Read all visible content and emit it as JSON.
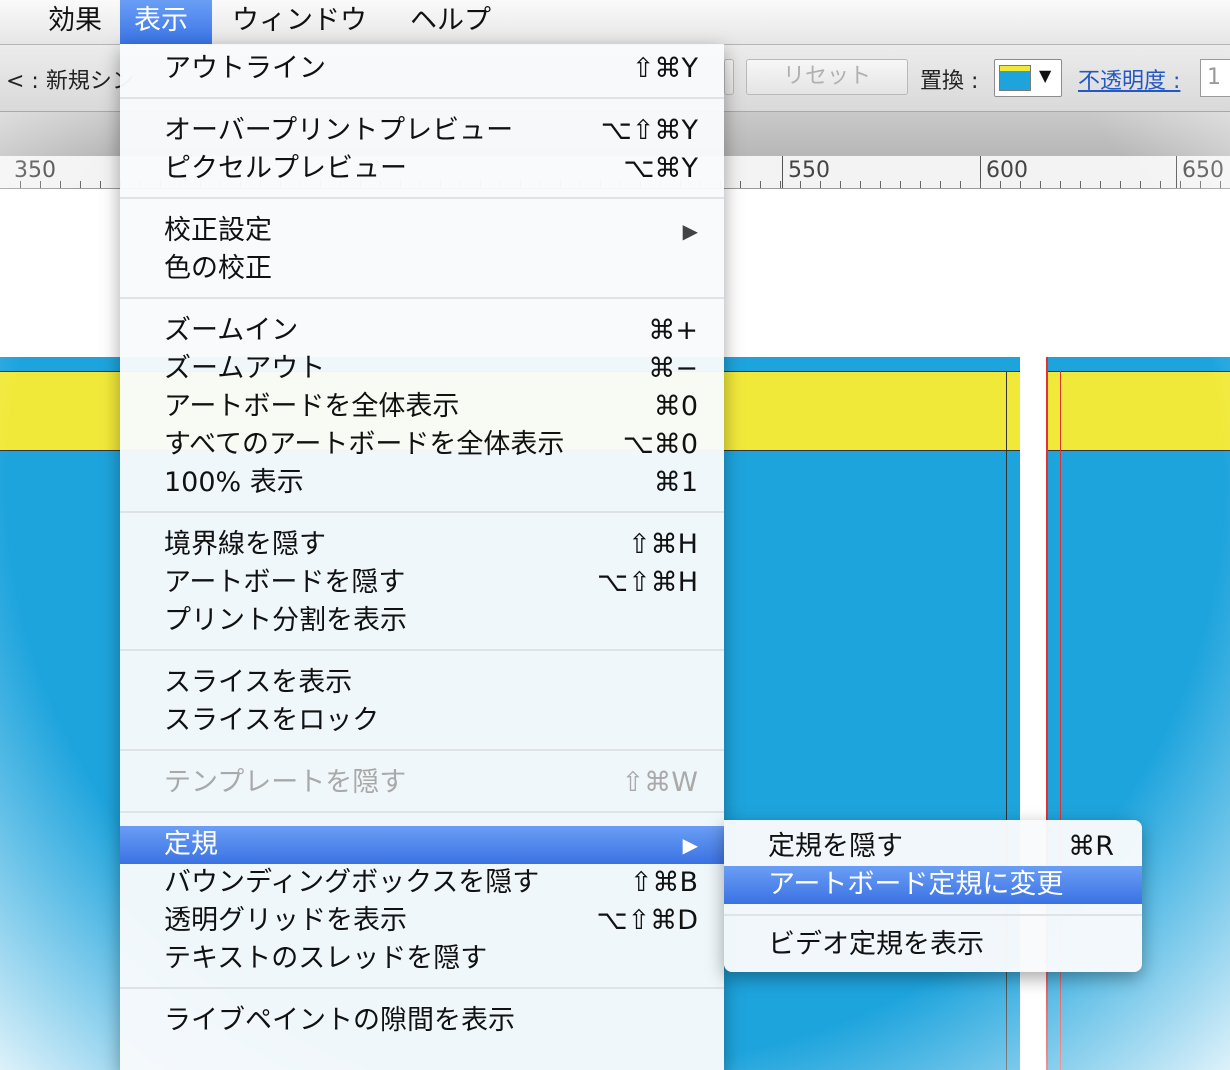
{
  "menubar": {
    "items": [
      {
        "label": "効果",
        "active": false
      },
      {
        "label": "表示",
        "active": true
      },
      {
        "label": "ウィンドウ",
        "active": false
      },
      {
        "label": "ヘルプ",
        "active": false
      }
    ]
  },
  "controlbar": {
    "new_symbol_partial": "< : 新規シン",
    "reset_label": "リセット",
    "replace_label": "置換 :",
    "opacity_label": "不透明度 :",
    "opacity_value": "1"
  },
  "ruler": {
    "labels": [
      "350",
      "550",
      "600",
      "650"
    ]
  },
  "view_menu": {
    "groups": [
      [
        {
          "label": "アウトライン",
          "shortcut": "⇧⌘Y"
        }
      ],
      [
        {
          "label": "オーバープリントプレビュー",
          "shortcut": "⌥⇧⌘Y"
        },
        {
          "label": "ピクセルプレビュー",
          "shortcut": "⌥⌘Y"
        }
      ],
      [
        {
          "label": "校正設定",
          "submenu": true
        },
        {
          "label": "色の校正"
        }
      ],
      [
        {
          "label": "ズームイン",
          "shortcut": "⌘+"
        },
        {
          "label": "ズームアウト",
          "shortcut": "⌘−"
        },
        {
          "label": "アートボードを全体表示",
          "shortcut": "⌘0"
        },
        {
          "label": "すべてのアートボードを全体表示",
          "shortcut": "⌥⌘0"
        },
        {
          "label": "100% 表示",
          "shortcut": "⌘1"
        }
      ],
      [
        {
          "label": "境界線を隠す",
          "shortcut": "⇧⌘H"
        },
        {
          "label": "アートボードを隠す",
          "shortcut": "⌥⇧⌘H"
        },
        {
          "label": "プリント分割を表示"
        }
      ],
      [
        {
          "label": "スライスを表示"
        },
        {
          "label": "スライスをロック"
        }
      ],
      [
        {
          "label": "テンプレートを隠す",
          "shortcut": "⇧⌘W",
          "disabled": true
        }
      ],
      [
        {
          "label": "定規",
          "submenu": true,
          "highlight": true
        },
        {
          "label": "バウンディングボックスを隠す",
          "shortcut": "⇧⌘B"
        },
        {
          "label": "透明グリッドを表示",
          "shortcut": "⌥⇧⌘D"
        },
        {
          "label": "テキストのスレッドを隠す"
        }
      ],
      [
        {
          "label": "ライブペイントの隙間を表示"
        }
      ]
    ],
    "submenu_arrow": "▶"
  },
  "ruler_submenu": {
    "items": [
      {
        "label": "定規を隠す",
        "shortcut": "⌘R"
      },
      {
        "label": "アートボード定規に変更",
        "highlight": true
      },
      {
        "label": "ビデオ定規を表示",
        "separator_before": true
      }
    ]
  },
  "colors": {
    "accent": "#3b72e3",
    "artboard_fill": "#1ea4dd",
    "artboard_band": "#f1e93a",
    "artboard_border_right": "#dd3333"
  }
}
